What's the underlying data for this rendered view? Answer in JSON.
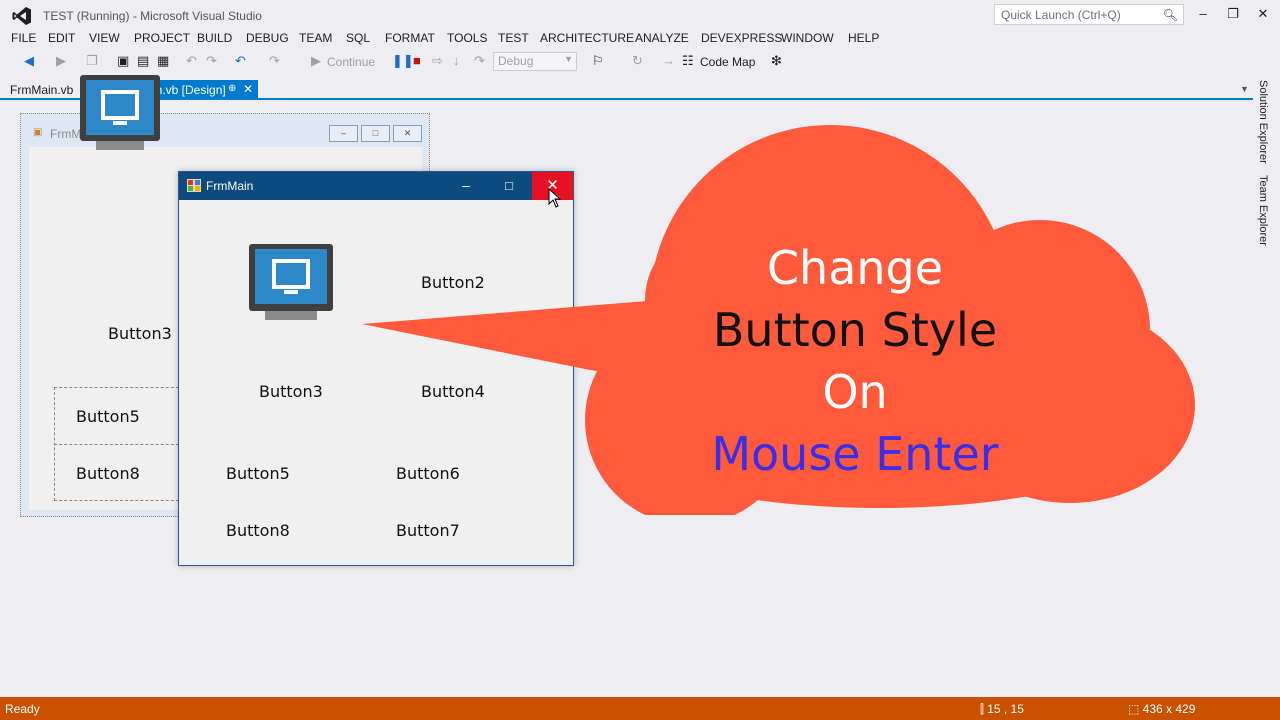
{
  "window": {
    "title": "TEST (Running) - Microsoft Visual Studio",
    "quick_launch_placeholder": "Quick Launch (Ctrl+Q)",
    "controls": [
      "–",
      "❐",
      "✕"
    ]
  },
  "menu": [
    "FILE",
    "EDIT",
    "VIEW",
    "PROJECT",
    "BUILD",
    "DEBUG",
    "TEAM",
    "SQL",
    "FORMAT",
    "TOOLS",
    "TEST",
    "ARCHITECTURE",
    "ANALYZE",
    "DEVEXPRESS",
    "WINDOW",
    "HELP"
  ],
  "toolbar": {
    "continue_label": "Continue",
    "configuration": "Debug",
    "code_map_label": "Code Map"
  },
  "tabs": {
    "code": "FrmMain.vb",
    "design": "FrmMain.vb [Design]"
  },
  "side_panel": {
    "solution_explorer": "Solution Explorer",
    "team_explorer": "Team Explorer"
  },
  "design_form": {
    "title": "FrmMain",
    "button3": "Button3",
    "button5": "Button5",
    "button8": "Button8"
  },
  "run_form": {
    "title": "FrmMain",
    "button2": "Button2",
    "button3": "Button3",
    "button4": "Button4",
    "button5": "Button5",
    "button6": "Button6",
    "button8": "Button8",
    "button7": "Button7"
  },
  "callout": {
    "line1": "Change",
    "line2": "Button Style",
    "line3": "On",
    "line4": "Mouse Enter",
    "colors": {
      "cloud": "#ff5a3c",
      "line1": "#ffffff",
      "line2": "#111111",
      "line3": "#ffffff",
      "line4": "#3b2ee8"
    }
  },
  "status": {
    "text": "Ready",
    "position": "15 , 15",
    "size": "436 x 429",
    "color": "#ca5100"
  },
  "accent": "#007acc"
}
